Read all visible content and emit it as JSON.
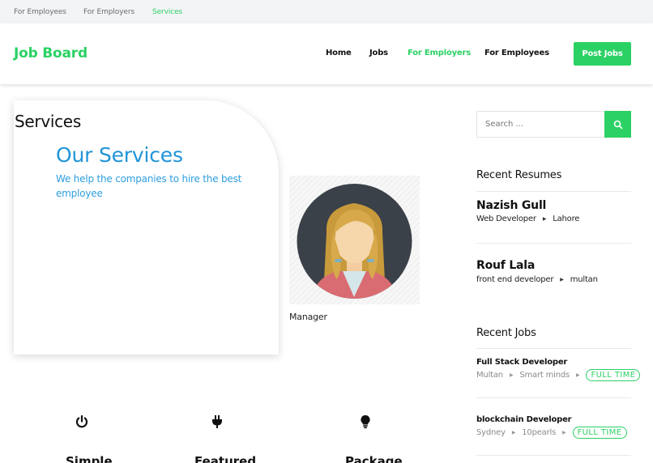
{
  "topbar": {
    "links": [
      "For Employees",
      "For Employers",
      "Services"
    ]
  },
  "header": {
    "logo": "Job Board",
    "nav": [
      "Home",
      "Jobs",
      "For Employers",
      "For Employees"
    ],
    "post_button": "Post Jobs"
  },
  "main": {
    "page_title": "Services",
    "services_title": "Our Services",
    "services_subtitle": "We help the companies to hire the best employee",
    "avatar_caption": "Manager",
    "features": [
      {
        "icon": "power-icon",
        "label": "Simple"
      },
      {
        "icon": "plug-icon",
        "label": "Featured"
      },
      {
        "icon": "lightbulb-icon",
        "label": "Package"
      }
    ]
  },
  "sidebar": {
    "search": {
      "placeholder": "Search ..."
    },
    "recent_resumes_heading": "Recent Resumes",
    "resumes": [
      {
        "name": "Nazish Gull",
        "role": "Web Developer",
        "location": "Lahore"
      },
      {
        "name": "Rouf Lala",
        "role": "front end developer",
        "location": "multan"
      }
    ],
    "recent_jobs_heading": "Recent Jobs",
    "jobs": [
      {
        "title": "Full Stack Developer",
        "location": "Multan",
        "company": "Smart minds",
        "type": "FULL TIME"
      },
      {
        "title": "blockchain Developer",
        "location": "Sydney",
        "company": "10pearls",
        "type": "FULL TIME"
      }
    ]
  },
  "colors": {
    "accent": "#2bd164",
    "services_blue": "#1f94d8"
  }
}
